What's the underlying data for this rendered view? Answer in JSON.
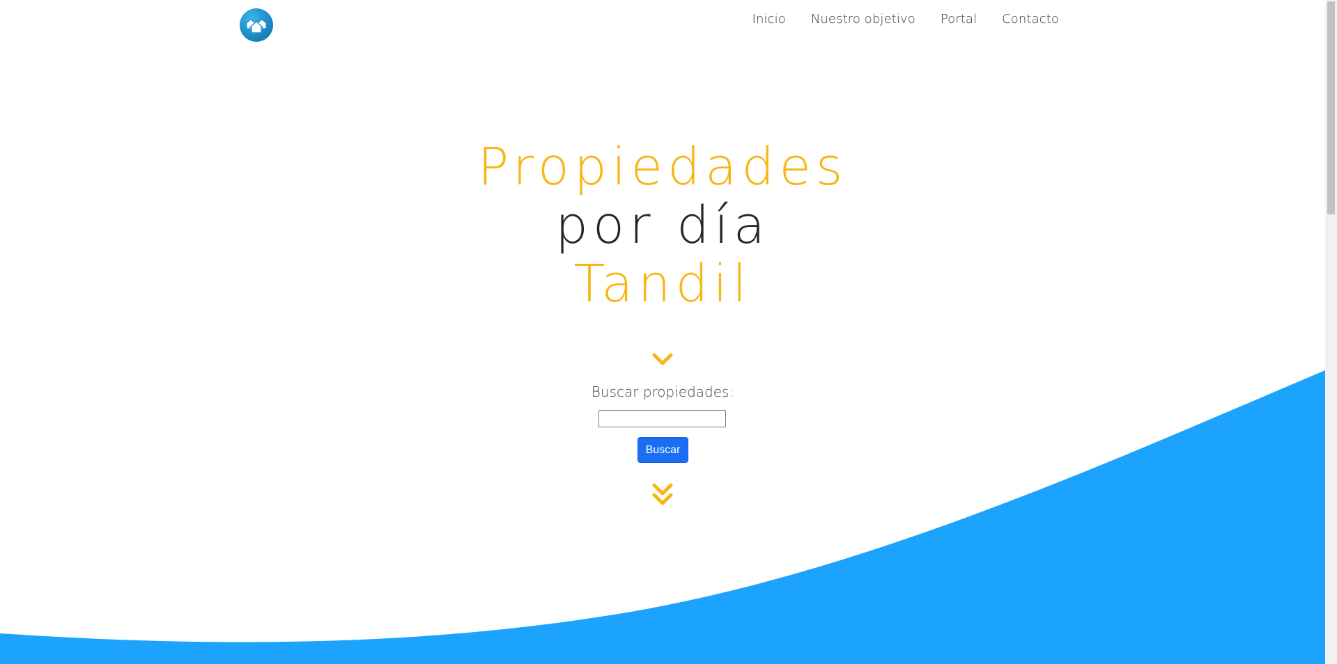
{
  "nav": {
    "logo_icon": "houses-logo-icon",
    "links": [
      {
        "label": "Inicio"
      },
      {
        "label": "Nuestro objetivo"
      },
      {
        "label": "Portal"
      },
      {
        "label": "Contacto"
      }
    ]
  },
  "hero": {
    "title_line1": "Propiedades",
    "title_line2": "por día",
    "title_line3": "Tandil",
    "chevron_icon": "chevron-down-icon",
    "double_chevron_icon": "double-chevron-down-icon"
  },
  "search": {
    "label": "Buscar propiedades:",
    "input_value": "",
    "button_label": "Buscar"
  },
  "colors": {
    "accent_yellow": "#f7b614",
    "wave_blue": "#1ca3fd",
    "button_blue": "#1a6ef3",
    "dark_text": "#22272e"
  }
}
